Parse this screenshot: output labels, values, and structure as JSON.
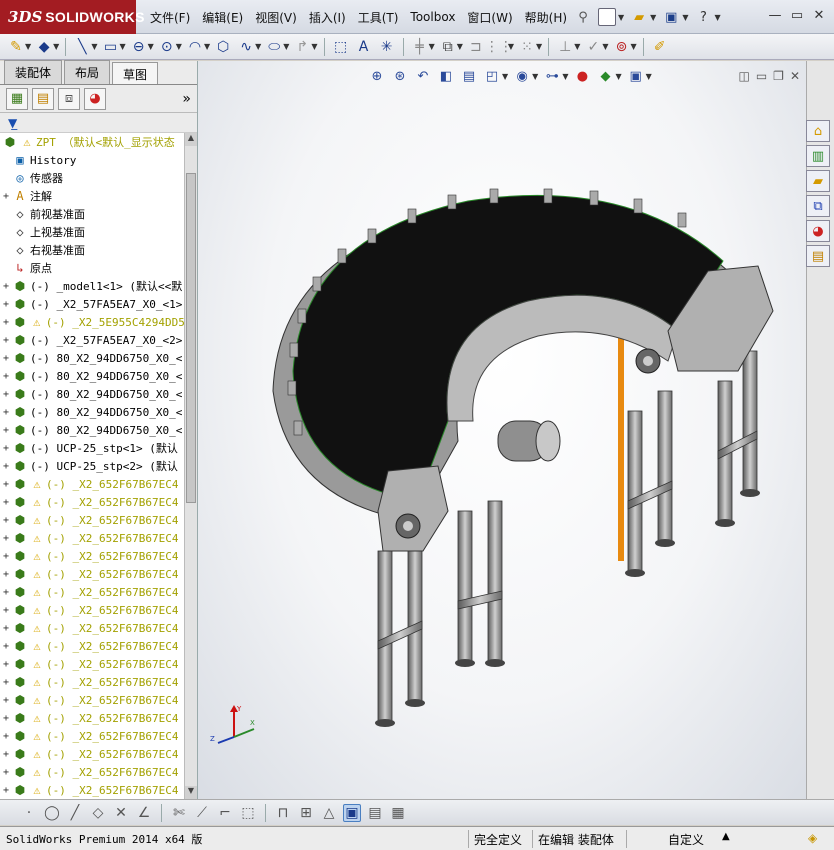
{
  "app": {
    "brand_mark": "3DS",
    "brand_name": "SOLIDWORKS"
  },
  "menu": {
    "items": [
      "文件(F)",
      "编辑(E)",
      "视图(V)",
      "插入(I)",
      "工具(T)",
      "Toolbox",
      "窗口(W)",
      "帮助(H)"
    ]
  },
  "window_buttons": {
    "minimize": "—",
    "restore": "▭",
    "close": "✕"
  },
  "left_panel": {
    "tabs": [
      "装配体",
      "布局",
      "草图"
    ],
    "active_tab": "草图",
    "root": {
      "name": "ZPT （默认<默认_显示状态"
    },
    "tree": [
      {
        "label": "History",
        "icon": "history-icon",
        "exp": "",
        "warn": false
      },
      {
        "label": "传感器",
        "icon": "sensor-icon",
        "exp": "",
        "warn": false
      },
      {
        "label": "注解",
        "icon": "annotation-icon",
        "exp": "+",
        "warn": false
      },
      {
        "label": "前视基准面",
        "icon": "plane-icon",
        "exp": "",
        "warn": false
      },
      {
        "label": "上视基准面",
        "icon": "plane-icon",
        "exp": "",
        "warn": false
      },
      {
        "label": "右视基准面",
        "icon": "plane-icon",
        "exp": "",
        "warn": false
      },
      {
        "label": "原点",
        "icon": "origin-icon",
        "exp": "",
        "warn": false
      },
      {
        "label": "(-) _model1<1> (默认<<默",
        "icon": "part-icon",
        "exp": "+",
        "warn": false
      },
      {
        "label": "(-) _X2_57FA5EA7_X0_<1>",
        "icon": "part-icon",
        "exp": "+",
        "warn": false
      },
      {
        "label": "(-) _X2_5E955C4294DD5",
        "icon": "part-icon",
        "exp": "+",
        "warn": true
      },
      {
        "label": "(-) _X2_57FA5EA7_X0_<2>",
        "icon": "part-icon",
        "exp": "+",
        "warn": false
      },
      {
        "label": "(-) 80_X2_94DD6750_X0_<",
        "icon": "part-icon",
        "exp": "+",
        "warn": false
      },
      {
        "label": "(-) 80_X2_94DD6750_X0_<",
        "icon": "part-icon",
        "exp": "+",
        "warn": false
      },
      {
        "label": "(-) 80_X2_94DD6750_X0_<",
        "icon": "part-icon",
        "exp": "+",
        "warn": false
      },
      {
        "label": "(-) 80_X2_94DD6750_X0_<",
        "icon": "part-icon",
        "exp": "+",
        "warn": false
      },
      {
        "label": "(-) 80_X2_94DD6750_X0_<",
        "icon": "part-icon",
        "exp": "+",
        "warn": false
      },
      {
        "label": "(-) UCP-25_stp<1> (默认",
        "icon": "part-icon",
        "exp": "+",
        "warn": false
      },
      {
        "label": "(-) UCP-25_stp<2> (默认",
        "icon": "part-icon",
        "exp": "+",
        "warn": false
      },
      {
        "label": "(-) _X2_652F67B67EC4",
        "icon": "part-icon",
        "exp": "+",
        "warn": true
      },
      {
        "label": "(-) _X2_652F67B67EC4",
        "icon": "part-icon",
        "exp": "+",
        "warn": true
      },
      {
        "label": "(-) _X2_652F67B67EC4",
        "icon": "part-icon",
        "exp": "+",
        "warn": true
      },
      {
        "label": "(-) _X2_652F67B67EC4",
        "icon": "part-icon",
        "exp": "+",
        "warn": true
      },
      {
        "label": "(-) _X2_652F67B67EC4",
        "icon": "part-icon",
        "exp": "+",
        "warn": true
      },
      {
        "label": "(-) _X2_652F67B67EC4",
        "icon": "part-icon",
        "exp": "+",
        "warn": true
      },
      {
        "label": "(-) _X2_652F67B67EC4",
        "icon": "part-icon",
        "exp": "+",
        "warn": true
      },
      {
        "label": "(-) _X2_652F67B67EC4",
        "icon": "part-icon",
        "exp": "+",
        "warn": true
      },
      {
        "label": "(-) _X2_652F67B67EC4",
        "icon": "part-icon",
        "exp": "+",
        "warn": true
      },
      {
        "label": "(-) _X2_652F67B67EC4",
        "icon": "part-icon",
        "exp": "+",
        "warn": true
      },
      {
        "label": "(-) _X2_652F67B67EC4",
        "icon": "part-icon",
        "exp": "+",
        "warn": true
      },
      {
        "label": "(-) _X2_652F67B67EC4",
        "icon": "part-icon",
        "exp": "+",
        "warn": true
      },
      {
        "label": "(-) _X2_652F67B67EC4",
        "icon": "part-icon",
        "exp": "+",
        "warn": true
      },
      {
        "label": "(-) _X2_652F67B67EC4",
        "icon": "part-icon",
        "exp": "+",
        "warn": true
      },
      {
        "label": "(-) _X2_652F67B67EC4",
        "icon": "part-icon",
        "exp": "+",
        "warn": true
      },
      {
        "label": "(-) _X2_652F67B67EC4",
        "icon": "part-icon",
        "exp": "+",
        "warn": true
      },
      {
        "label": "(-) _X2_652F67B67EC4",
        "icon": "part-icon",
        "exp": "+",
        "warn": true
      },
      {
        "label": "(-) _X2_652F67B67EC4",
        "icon": "part-icon",
        "exp": "+",
        "warn": true
      }
    ]
  },
  "status_bar": {
    "product": "SolidWorks Premium 2014 x64 版",
    "definition": "完全定义",
    "editing": "在编辑 装配体",
    "units": "自定义",
    "arrow": "▲"
  },
  "colors": {
    "brand_red": "#a31c22",
    "belt": "#111111",
    "frame": "#8a8a8a",
    "accent_orange": "#e88a10",
    "warning_text": "#a3a100"
  }
}
